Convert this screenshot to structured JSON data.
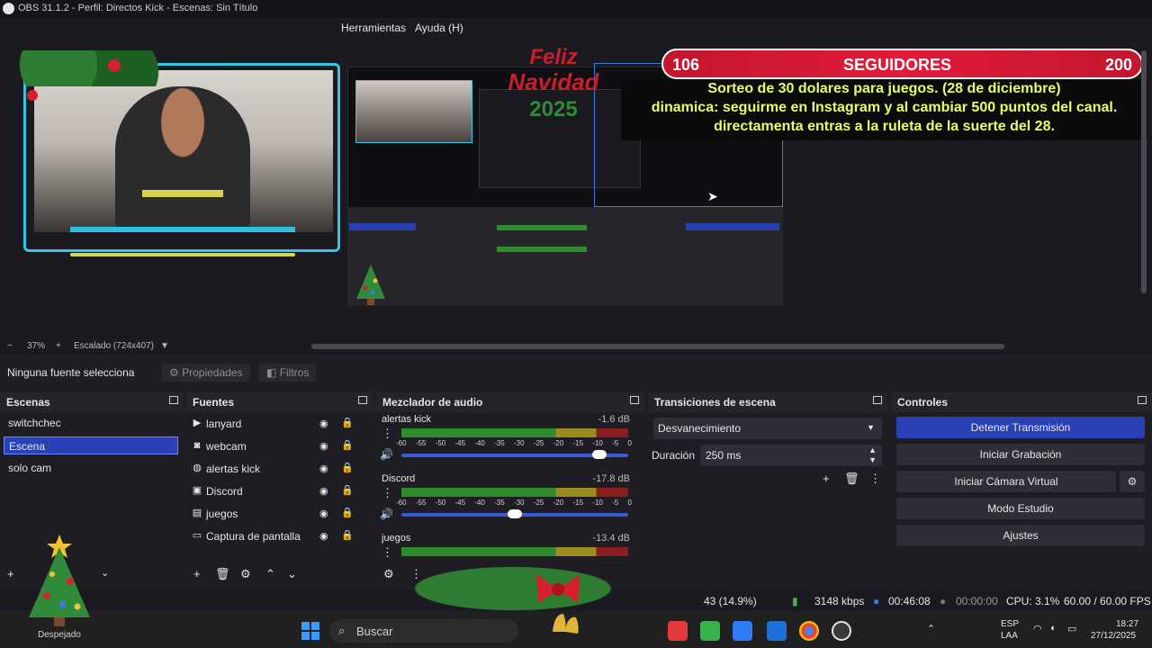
{
  "window": {
    "title": "OBS 31.1.2 - Perfil: Directos Kick - Escenas: Sin Título"
  },
  "menu": {
    "items": [
      "Herramientas",
      "Ayuda (H)"
    ]
  },
  "overlay": {
    "counter_left": "106",
    "counter_label": "SEGUIDORES",
    "counter_right": "200",
    "sorteo_lines": [
      "Sorteo de 30 dolares para juegos. (28 de diciembre)",
      "dinamica: seguirme en Instagram y al cambiar 500 puntos del canal.",
      "directamenta entras a la ruleta de la suerte del 28."
    ],
    "xmas_line1": "Feliz",
    "xmas_line2": "Navidad",
    "xmas_year": "2025"
  },
  "zoom": {
    "value": "37%",
    "scaling": "Escalado (724x407)"
  },
  "source_toolbar": {
    "no_selection": "Ninguna fuente selecciona",
    "properties": "Propiedades",
    "filters": "Filtros"
  },
  "scenes": {
    "title": "Escenas",
    "items": [
      "switchchec",
      "Escena",
      "solo cam"
    ],
    "selected_index": 1
  },
  "sources": {
    "title": "Fuentes",
    "items": [
      {
        "label": "lanyard",
        "icon": "play-icon"
      },
      {
        "label": "webcam",
        "icon": "camera-icon"
      },
      {
        "label": "alertas kick",
        "icon": "browser-icon"
      },
      {
        "label": "Discord",
        "icon": "window-icon"
      },
      {
        "label": "juegos",
        "icon": "game-icon"
      },
      {
        "label": "Captura de pantalla",
        "icon": "monitor-icon"
      }
    ]
  },
  "mixer": {
    "title": "Mezclador de audio",
    "scale": [
      "-60",
      "-55",
      "-50",
      "-45",
      "-40",
      "-35",
      "-30",
      "-25",
      "-20",
      "-15",
      "-10",
      "-5",
      "0"
    ],
    "channels": [
      {
        "name": "alertas kick",
        "db": "-1.6 dB",
        "level": 0.9
      },
      {
        "name": "Discord",
        "db": "-17.8 dB",
        "level": 0.5
      },
      {
        "name": "juegos",
        "db": "-13.4 dB",
        "level": 0.6
      }
    ]
  },
  "transitions": {
    "title": "Transiciones de escena",
    "selected": "Desvanecimiento",
    "duration_label": "Duración",
    "duration_value": "250 ms"
  },
  "controls": {
    "title": "Controles",
    "buttons": [
      {
        "label": "Detener Transmisión",
        "active": true
      },
      {
        "label": "Iniciar Grabación",
        "active": false
      },
      {
        "label": "Iniciar Cámara Virtual",
        "active": false
      },
      {
        "label": "Modo Estudio",
        "active": false
      },
      {
        "label": "Ajustes",
        "active": false
      }
    ]
  },
  "status": {
    "frames": "43 (14.9%)",
    "bitrate": "3148 kbps",
    "stream_time": "00:46:08",
    "rec_time": "00:00:00",
    "cpu": "CPU: 3.1%",
    "fps": "60.00 / 60.00 FPS"
  },
  "taskbar": {
    "search_placeholder": "Buscar",
    "weather": "Despejado",
    "lang_line1": "ESP",
    "lang_line2": "LAA",
    "time": "18:27",
    "date": "27/12/2025"
  },
  "colors": {
    "accent": "#2a41b5",
    "bg": "#1f1e24",
    "dock": "#25242b",
    "counter_red": "#e11b3a",
    "sorteo_text": "#e8ff6a"
  }
}
